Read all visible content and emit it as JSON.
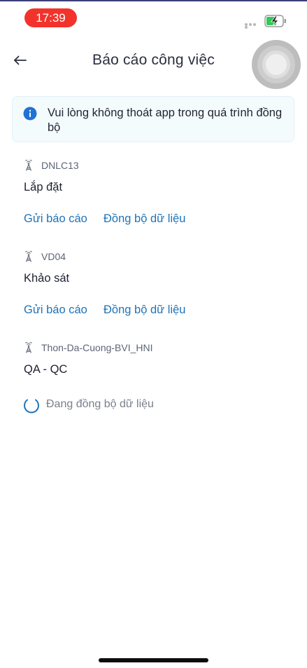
{
  "status_bar": {
    "time": "17:39",
    "icons": [
      "signal-dots-icon",
      "battery-charging-icon"
    ]
  },
  "header": {
    "title": "Báo cáo công việc",
    "back_icon": "arrow-left-icon"
  },
  "info_banner": {
    "icon": "info-icon",
    "text": "Vui lòng không thoát app trong quá trình đồng bộ"
  },
  "tasks": [
    {
      "station": "DNLC13",
      "name": "Lắp đặt",
      "send_report_label": "Gửi báo cáo",
      "sync_label": "Đồng bộ dữ liệu"
    },
    {
      "station": "VD04",
      "name": "Khảo sát",
      "send_report_label": "Gửi báo cáo",
      "sync_label": "Đồng bộ dữ liệu"
    },
    {
      "station": "Thon-Da-Cuong-BVI_HNI",
      "name": "QA - QC",
      "syncing_text": "Đang đồng bộ dữ liệu"
    }
  ],
  "colors": {
    "accent": "#1f73b7",
    "time_pill": "#f2332b",
    "info": "#1f73d4",
    "banner_bg": "#f4fbfd"
  }
}
